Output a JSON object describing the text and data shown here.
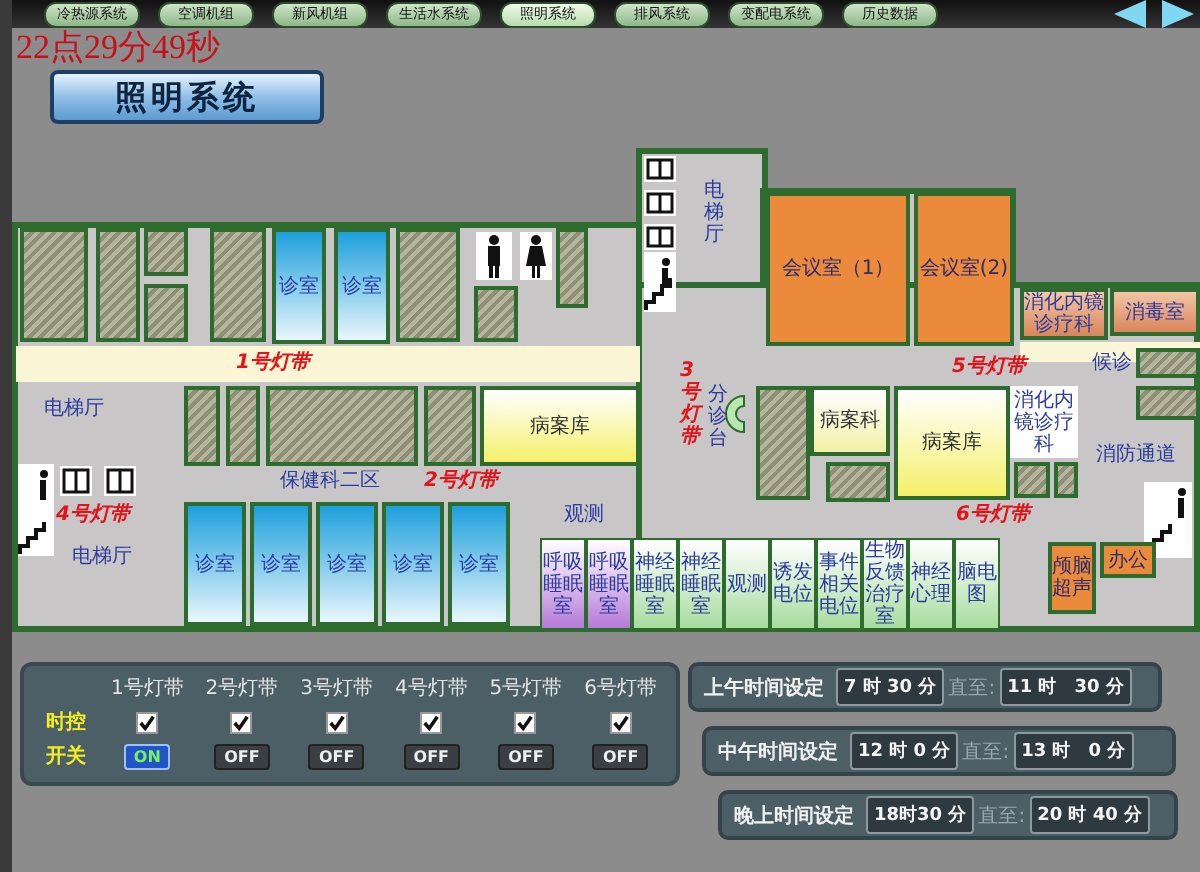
{
  "nav": {
    "tabs": [
      {
        "label": "冷热源系统",
        "selected": false
      },
      {
        "label": "空调机组",
        "selected": false
      },
      {
        "label": "新风机组",
        "selected": false
      },
      {
        "label": "生活水系统",
        "selected": false
      },
      {
        "label": "照明系统",
        "selected": true
      },
      {
        "label": "排风系统",
        "selected": false
      },
      {
        "label": "变配电系统",
        "selected": false
      },
      {
        "label": "历史数据",
        "selected": false
      }
    ]
  },
  "clock": "22点29分49秒",
  "page_title": "照明系统",
  "floor_plan": {
    "rooms": [
      {
        "kind": "clinic",
        "label": "诊室"
      },
      {
        "kind": "clinic",
        "label": "诊室"
      },
      {
        "kind": "label",
        "label": "电梯厅"
      },
      {
        "kind": "label",
        "label": "电梯厅"
      },
      {
        "kind": "archive",
        "label": "病案库"
      },
      {
        "kind": "label",
        "label": "保健科二区"
      },
      {
        "kind": "clinic",
        "label": "诊室"
      },
      {
        "kind": "clinic",
        "label": "诊室"
      },
      {
        "kind": "clinic",
        "label": "诊室"
      },
      {
        "kind": "clinic",
        "label": "诊室"
      },
      {
        "kind": "clinic",
        "label": "诊室"
      },
      {
        "kind": "label",
        "label": "观测"
      },
      {
        "kind": "sleep",
        "label": "呼吸睡眠室"
      },
      {
        "kind": "sleep",
        "label": "呼吸睡眠室"
      },
      {
        "kind": "test",
        "label": "神经睡眠室"
      },
      {
        "kind": "test",
        "label": "神经睡眠室"
      },
      {
        "kind": "test",
        "label": "观测"
      },
      {
        "kind": "test",
        "label": "诱发电位"
      },
      {
        "kind": "test",
        "label": "事件相关电位"
      },
      {
        "kind": "test",
        "label": "生物反馈治疗室"
      },
      {
        "kind": "test",
        "label": "神经心理"
      },
      {
        "kind": "test",
        "label": "脑电图"
      },
      {
        "kind": "office",
        "label": "颅脑超声"
      },
      {
        "kind": "office",
        "label": "办公"
      },
      {
        "kind": "vlabel",
        "label": "电梯厅"
      },
      {
        "kind": "office",
        "label": "会议室（1）"
      },
      {
        "kind": "office",
        "label": "会议室(2)"
      },
      {
        "kind": "treatment",
        "label": "消化内镜诊疗科"
      },
      {
        "kind": "treatment",
        "label": "消毒室"
      },
      {
        "kind": "label",
        "label": "候诊"
      },
      {
        "kind": "vlabel",
        "label": "分诊台"
      },
      {
        "kind": "records",
        "label": "病案科"
      },
      {
        "kind": "archive",
        "label": "病案库"
      },
      {
        "kind": "plain",
        "label": "消化内镜诊疗科"
      },
      {
        "kind": "label",
        "label": "消防通道"
      }
    ],
    "light_bands": [
      {
        "label": "1号灯带"
      },
      {
        "label": "2号灯带"
      },
      {
        "label": "3号灯带"
      },
      {
        "label": "4号灯带"
      },
      {
        "label": "5号灯带"
      },
      {
        "label": "6号灯带"
      }
    ]
  },
  "control_panel": {
    "row_labels": [
      "时控",
      "开关"
    ],
    "bands": [
      {
        "label": "1号灯带",
        "timed": true,
        "on": true,
        "switch": "ON"
      },
      {
        "label": "2号灯带",
        "timed": true,
        "on": false,
        "switch": "OFF"
      },
      {
        "label": "3号灯带",
        "timed": true,
        "on": false,
        "switch": "OFF"
      },
      {
        "label": "4号灯带",
        "timed": true,
        "on": false,
        "switch": "OFF"
      },
      {
        "label": "5号灯带",
        "timed": true,
        "on": false,
        "switch": "OFF"
      },
      {
        "label": "6号灯带",
        "timed": true,
        "on": false,
        "switch": "OFF"
      }
    ]
  },
  "schedules": [
    {
      "label": "上午时间设定",
      "start": "7 时 30 分",
      "until": "直至:",
      "end": "11 时　30 分"
    },
    {
      "label": "中午时间设定",
      "start": "12 时 0 分",
      "until": "直至:",
      "end": "13 时　0 分"
    },
    {
      "label": "晚上时间设定",
      "start": "18时30 分",
      "until": "直至:",
      "end": "20 时 40 分"
    }
  ]
}
